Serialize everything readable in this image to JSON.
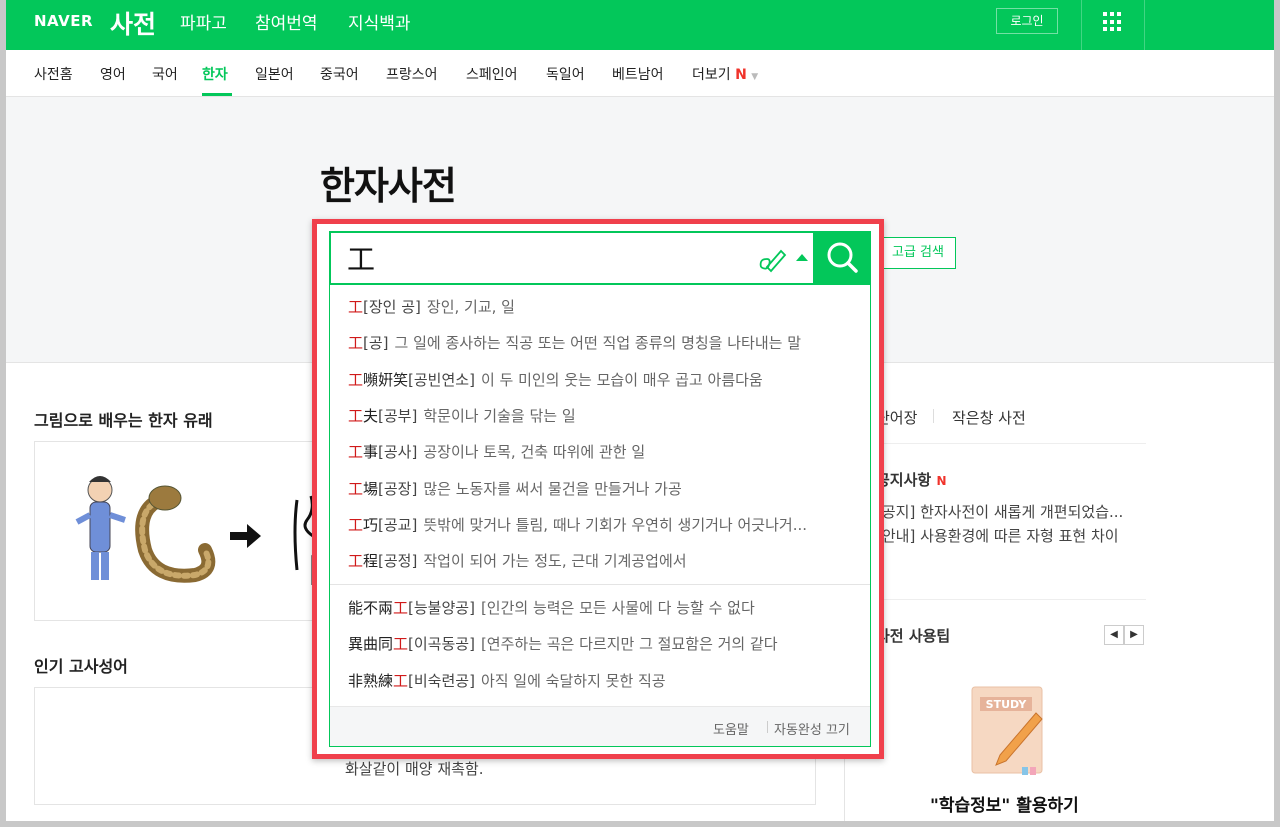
{
  "header": {
    "logo": "NAVER",
    "dict_title": "사전",
    "nav": [
      "파파고",
      "참여번역",
      "지식백과"
    ],
    "login_label": "로그인"
  },
  "subnav": {
    "items": [
      "사전홈",
      "영어",
      "국어",
      "한자",
      "일본어",
      "중국어",
      "프랑스어",
      "스페인어",
      "독일어",
      "베트남어",
      "더보기"
    ],
    "active": "한자",
    "new_mark": "N"
  },
  "hero": {
    "title": "한자사전",
    "advanced_search_label": "고급 검색"
  },
  "search": {
    "value": "工"
  },
  "suggestions": [
    {
      "hl_pre": "",
      "hl": "工",
      "hl_post": "",
      "reading": "[장인 공]",
      "desc": "장인, 기교, 일"
    },
    {
      "hl_pre": "",
      "hl": "工",
      "hl_post": "",
      "reading": "[공]",
      "desc": "그 일에 종사하는 직공 또는 어떤 직업 종류의 명칭을 나타내는 말"
    },
    {
      "hl_pre": "",
      "hl": "工",
      "hl_post": "嚬姸笑",
      "reading": "[공빈연소]",
      "desc": "이 두 미인의 웃는 모습이 매우 곱고 아름다움"
    },
    {
      "hl_pre": "",
      "hl": "工",
      "hl_post": "夫",
      "reading": "[공부]",
      "desc": "학문이나 기술을 닦는 일"
    },
    {
      "hl_pre": "",
      "hl": "工",
      "hl_post": "事",
      "reading": "[공사]",
      "desc": "공장이나 토목, 건축 따위에 관한 일"
    },
    {
      "hl_pre": "",
      "hl": "工",
      "hl_post": "場",
      "reading": "[공장]",
      "desc": "많은 노동자를 써서 물건을 만들거나 가공"
    },
    {
      "hl_pre": "",
      "hl": "工",
      "hl_post": "巧",
      "reading": "[공교]",
      "desc": "뜻밖에 맞거나 틀림, 때나 기회가 우연히 생기거나 어긋나거..."
    },
    {
      "hl_pre": "",
      "hl": "工",
      "hl_post": "程",
      "reading": "[공정]",
      "desc": "작업이 되어 가는 정도, 근대 기계공업에서"
    }
  ],
  "idioms": [
    {
      "hl_pre": "能不兩",
      "hl": "工",
      "hl_post": "",
      "reading": "[능불양공]",
      "desc": "[인간의 능력은 모든 사물에 다 능할 수 없다"
    },
    {
      "hl_pre": "異曲同",
      "hl": "工",
      "hl_post": "",
      "reading": "[이곡동공]",
      "desc": "[연주하는 곡은 다르지만 그 절묘함은 거의 같다"
    },
    {
      "hl_pre": "非熟練",
      "hl": "工",
      "hl_post": "",
      "reading": "[비숙련공]",
      "desc": "아직 일에 숙달하지 못한 직공"
    }
  ],
  "suggest_footer": {
    "help": "도움말",
    "autocomplete_off": "자동완성 끄기"
  },
  "left": {
    "origin_title": "그림으로 배우는 한자 유래",
    "idiom_title": "인기 고사성어",
    "idiom_partial_text": "화살같이 매양 재촉함."
  },
  "right": {
    "tabs": [
      "단어장",
      "작은창 사전"
    ],
    "notice_title": "공지사항",
    "notice_new": "N",
    "notices": [
      "[공지] 한자사전이 새롭게 개편되었습...",
      "[안내] 사용환경에 따른 자형 표현 차이"
    ],
    "tips_title": "사전 사용팁",
    "study_badge": "STUDY",
    "study_label": "\"학습정보\" 활용하기"
  },
  "colors": {
    "brand": "#03c75a",
    "highlight": "#d01a1a",
    "overlay_border": "#f0404c"
  }
}
